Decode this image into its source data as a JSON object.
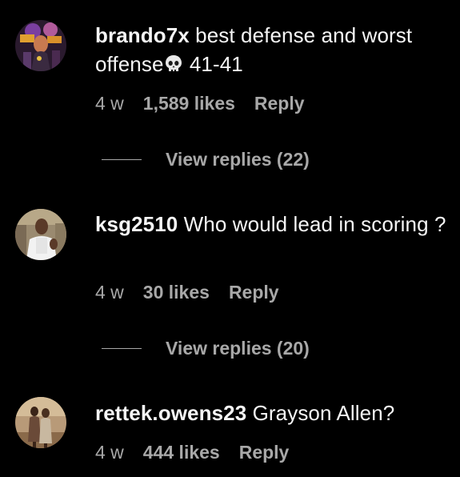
{
  "comments": [
    {
      "username": "brando7x",
      "text_before": "best defense and worst offense",
      "emoji": "skull-icon",
      "text_after": " 41-41",
      "time": "4 w",
      "likes": "1,589 likes",
      "reply": "Reply",
      "view_replies": "View replies (22)"
    },
    {
      "username": "ksg2510",
      "text": "Who would lead in scoring ?",
      "time": "4 w",
      "likes": "30 likes",
      "reply": "Reply",
      "view_replies": "View replies (20)"
    },
    {
      "username": "rettek.owens23",
      "text": "Grayson Allen?",
      "time": "4 w",
      "likes": "444 likes",
      "reply": "Reply"
    }
  ],
  "colors": {
    "background": "#000000",
    "primary_text": "#f5f5f5",
    "secondary_text": "#a8a8a8"
  }
}
